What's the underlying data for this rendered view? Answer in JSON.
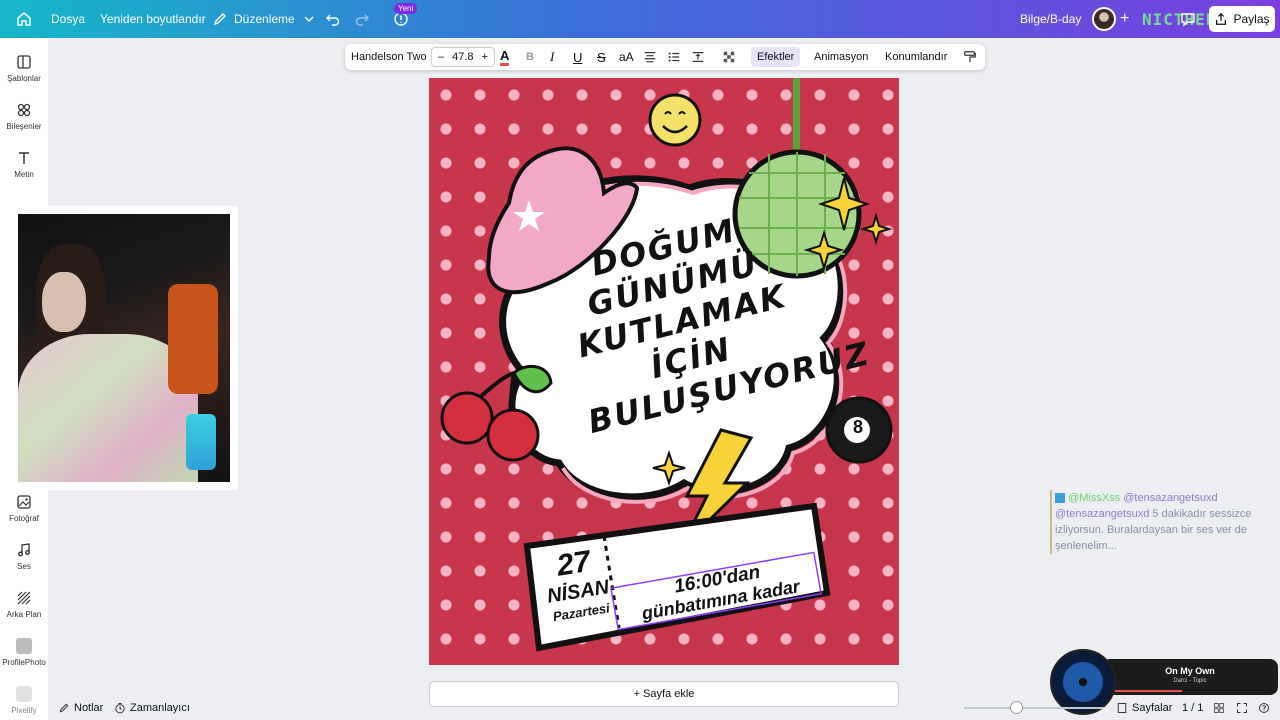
{
  "topbar": {
    "menu_file": "Dosya",
    "menu_resize": "Yeniden boyutlandır",
    "menu_edit": "Düzenleme",
    "badge_new": "Yeni",
    "project_name": "Bilge/B-day",
    "share_label": "Paylaş",
    "watermark": "NICTHEPH"
  },
  "sidebar": {
    "items": [
      {
        "label": "Şablonlar"
      },
      {
        "label": "Bileşenler"
      },
      {
        "label": "Metin"
      },
      {
        "label": "Fotoğraf"
      },
      {
        "label": "Ses"
      },
      {
        "label": "Arka Plan"
      },
      {
        "label": "ProfilePhoto"
      },
      {
        "label": "Pixelify"
      }
    ]
  },
  "toolbar": {
    "font_name": "Handelson Two",
    "font_size": "47.8",
    "minus": "–",
    "plus": "+",
    "effects": "Efektler",
    "animation": "Animasyon",
    "position": "Konumlandır",
    "aA": "aA"
  },
  "poster": {
    "headline_lines": [
      "DOĞUM",
      "GÜNÜMÜ",
      "KUTLAMAK",
      "İÇİN",
      "BULUŞUYORUZ"
    ],
    "day_number": "27",
    "month": "NİSAN",
    "weekday": "Pazartesi",
    "time_line1": "16:00'dan",
    "time_line2": "günbatımına kadar",
    "eight_ball": "8"
  },
  "add_page": "+ Sayfa ekle",
  "chat": {
    "user1": "@MissXss",
    "mention": "@tensazangetsuxd",
    "message_prefix": "@tensazangetsuxd",
    "message": "5 dakikadır sessizce izliyorsun. Buralardaysan bir ses ver de şenlenelim..."
  },
  "music": {
    "title": "On My Own",
    "artist": "Darci - Topic"
  },
  "bottom": {
    "notes": "Notlar",
    "timer": "Zamanlayıcı",
    "pages": "Sayfalar",
    "page_count": "1 / 1"
  }
}
